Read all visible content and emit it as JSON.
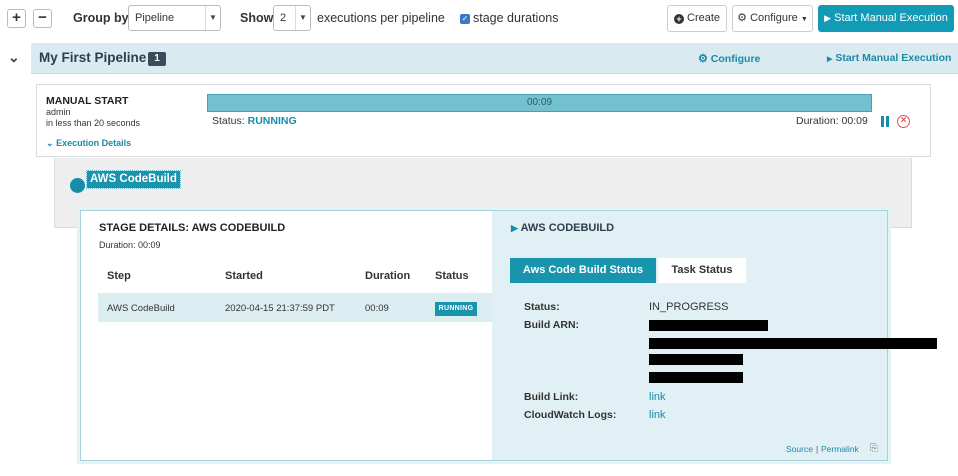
{
  "toolbar": {
    "expand_label": "+",
    "collapse_label": "−",
    "group_by_label": "Group by",
    "group_by_value": "Pipeline",
    "show_label": "Show",
    "show_value": "2",
    "executions_suffix": "executions per pipeline",
    "stage_durations_label": "stage durations",
    "stage_durations_checked": true,
    "create_label": "Create",
    "configure_label": "Configure",
    "start_manual_label": "Start Manual Execution"
  },
  "pipeline": {
    "name": "My First Pipeline",
    "count": "1",
    "configure_label": "Configure",
    "start_manual_label": "Start Manual Execution"
  },
  "execution": {
    "trigger": "MANUAL START",
    "user": "admin",
    "when": "in less than 20 seconds",
    "details_link": "Execution Details",
    "progress_time": "00:09",
    "status_label": "Status:",
    "status_value": "RUNNING",
    "duration_text": "Duration: 00:09"
  },
  "stage": {
    "name": "AWS CodeBuild"
  },
  "stage_details": {
    "title": "STAGE DETAILS: AWS CODEBUILD",
    "duration": "Duration: 00:09",
    "columns": [
      "Step",
      "Started",
      "Duration",
      "Status"
    ],
    "rows": [
      {
        "step": "AWS CodeBuild",
        "started": "2020-04-15 21:37:59 PDT",
        "duration": "00:09",
        "status": "RUNNING"
      }
    ]
  },
  "build_panel": {
    "title": "AWS CODEBUILD",
    "tabs": [
      "Aws Code Build Status",
      "Task Status"
    ],
    "fields": {
      "status_label": "Status:",
      "status_value": "IN_PROGRESS",
      "arn_label": "Build ARN:",
      "build_link_label": "Build Link:",
      "build_link_value": "link",
      "cloudwatch_label": "CloudWatch Logs:",
      "cloudwatch_value": "link"
    },
    "source_label": "Source",
    "separator": "|",
    "permalink_label": "Permalink"
  },
  "colors": {
    "accent": "#139bb5",
    "running": "#1894ad",
    "header_bg": "#d9ebf1",
    "cancel": "#d9534f"
  }
}
